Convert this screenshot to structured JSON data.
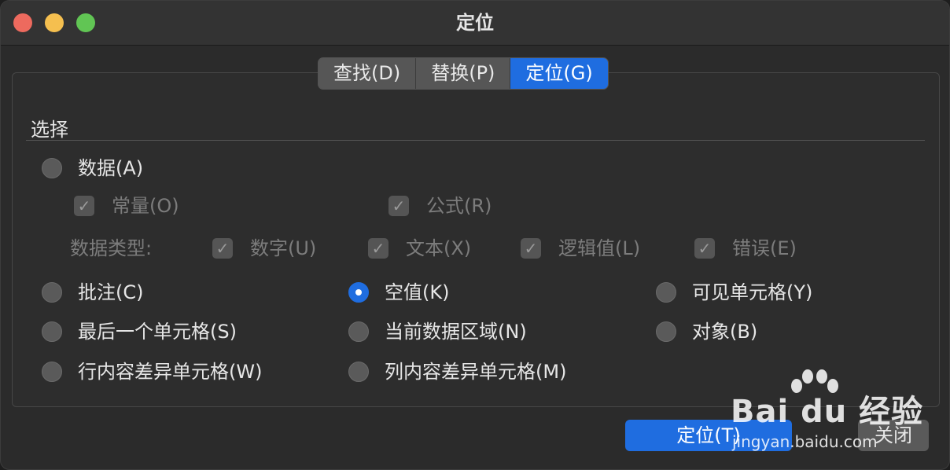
{
  "window": {
    "title": "定位"
  },
  "tabs": [
    {
      "label": "查找(D)",
      "active": false
    },
    {
      "label": "替换(P)",
      "active": false
    },
    {
      "label": "定位(G)",
      "active": true
    }
  ],
  "section": {
    "label": "选择"
  },
  "options": {
    "data": {
      "label": "数据(A)",
      "selected": false
    },
    "constants": {
      "label": "常量(O)",
      "checked": true,
      "enabled": false
    },
    "formulas": {
      "label": "公式(R)",
      "checked": true,
      "enabled": false
    },
    "data_types": {
      "label": "数据类型:",
      "numbers": {
        "label": "数字(U)",
        "checked": true
      },
      "text": {
        "label": "文本(X)",
        "checked": true
      },
      "logical": {
        "label": "逻辑值(L)",
        "checked": true
      },
      "errors": {
        "label": "错误(E)",
        "checked": true
      }
    },
    "comments": {
      "label": "批注(C)",
      "selected": false
    },
    "blanks": {
      "label": "空值(K)",
      "selected": true
    },
    "visible_cells": {
      "label": "可见单元格(Y)",
      "selected": false
    },
    "last_cell": {
      "label": "最后一个单元格(S)",
      "selected": false
    },
    "current_region": {
      "label": "当前数据区域(N)",
      "selected": false
    },
    "objects": {
      "label": "对象(B)",
      "selected": false
    },
    "row_differences": {
      "label": "行内容差异单元格(W)",
      "selected": false
    },
    "column_differences": {
      "label": "列内容差异单元格(M)",
      "selected": false
    }
  },
  "buttons": {
    "locate": "定位(T)",
    "close": "关闭"
  },
  "watermark": {
    "brand": "Bai du 经验",
    "url": "jingyan.baidu.com"
  },
  "colors": {
    "accent": "#1f6de0",
    "background": "#2b2b2b",
    "close_light": "#ed6a5e",
    "minimize_light": "#f5bf4f",
    "zoom_light": "#61c554"
  }
}
